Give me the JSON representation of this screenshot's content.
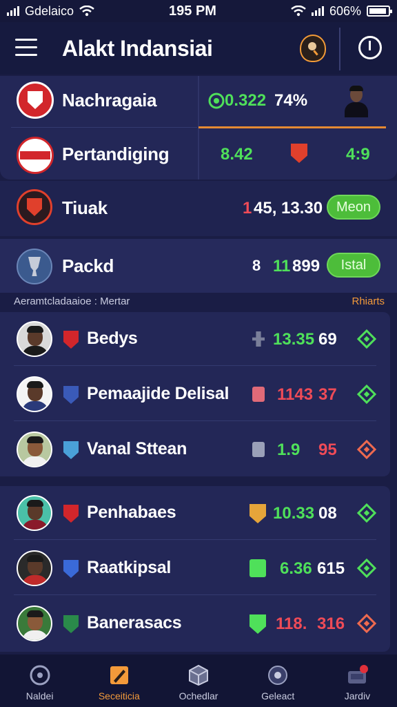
{
  "status_bar": {
    "carrier": "Gdelaico",
    "time": "195 PM",
    "battery": "606%"
  },
  "header": {
    "title": "Alakt Indansiai"
  },
  "summary": {
    "row1": {
      "label": "Nachragaia",
      "value_a": "0.322",
      "value_b": "74%"
    },
    "row2": {
      "label": "Pertandiging",
      "value_a": "8.42",
      "value_b": "4:9"
    }
  },
  "feature_rows": [
    {
      "label": "Tiuak",
      "value_red": "1",
      "value_white": "45, 13.30",
      "pill": "Meon"
    },
    {
      "label": "Packd",
      "value_prefix": "8",
      "value_green": "11",
      "value_white": "899",
      "pill": "Istal"
    }
  ],
  "section": {
    "left": "Aeramtcladaaioe : Mertar",
    "right": "Rhiarts"
  },
  "players_group1": [
    {
      "name": "Bedys",
      "stat1": "13.35",
      "stat2": "69",
      "stat1_color": "green",
      "stat2_color": "white",
      "diamond": "green"
    },
    {
      "name": "Pemaajide Delisal",
      "stat1": "1143",
      "stat2": "37",
      "stat1_color": "red",
      "stat2_color": "red",
      "diamond": "green"
    },
    {
      "name": "Vanal Sttean",
      "stat1": "1.9",
      "stat2": "95",
      "stat1_color": "green",
      "stat2_color": "red",
      "diamond": "red"
    }
  ],
  "players_group2": [
    {
      "name": "Penhabaes",
      "stat1": "10.33",
      "stat2": "08",
      "stat1_color": "green",
      "stat2_color": "white",
      "diamond": "green"
    },
    {
      "name": "Raatkipsal",
      "stat1": "6.36",
      "stat2": "615",
      "stat1_color": "green",
      "stat2_color": "white",
      "diamond": "green"
    },
    {
      "name": "Banerasacs",
      "stat1": "118.",
      "stat2": "316",
      "stat1_color": "red",
      "stat2_color": "red",
      "diamond": "red"
    }
  ],
  "bottom_nav": [
    {
      "label": "Naldei",
      "icon": "soccer-ball-icon"
    },
    {
      "label": "Seceiticia",
      "icon": "pencil-card-icon",
      "active": true
    },
    {
      "label": "Ochedlar",
      "icon": "cube-icon"
    },
    {
      "label": "Geleact",
      "icon": "target-icon"
    },
    {
      "label": "Jardiv",
      "icon": "store-icon"
    }
  ],
  "colors": {
    "background": "#1a1d45",
    "card": "#232757",
    "accent": "#f39a3a",
    "green": "#4fe05a",
    "red": "#ef4b57"
  }
}
